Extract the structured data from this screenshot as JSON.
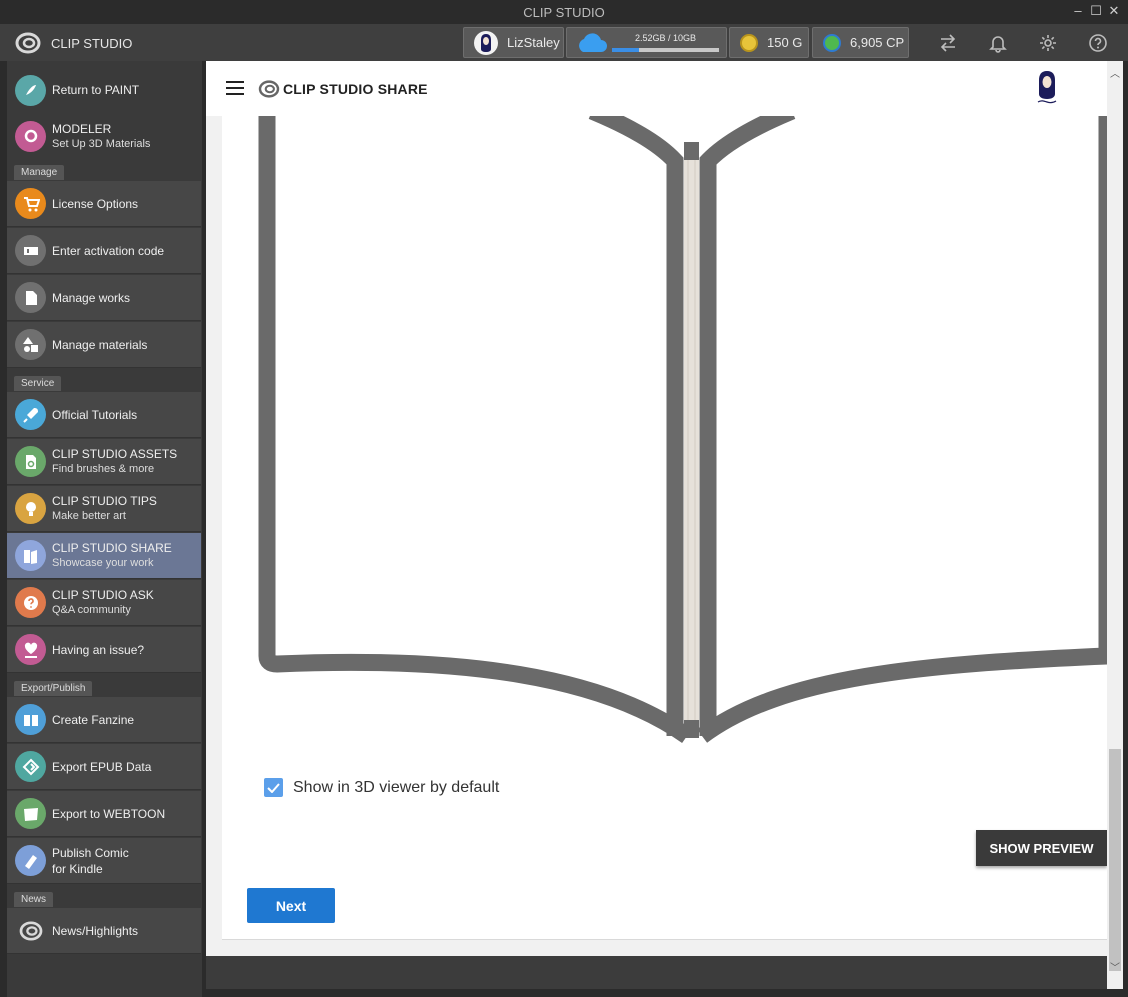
{
  "window": {
    "title": "CLIP STUDIO",
    "controls": [
      "–",
      "☐",
      "✕"
    ]
  },
  "appbar": {
    "brand": "CLIP STUDIO",
    "user": "LizStaley",
    "storage": {
      "text": "2.52GB / 10GB",
      "used_fraction": 0.252
    },
    "gold": "150 G",
    "cp": "6,905 CP",
    "icons": [
      "sync-icon",
      "bell-icon",
      "gear-icon",
      "help-icon"
    ]
  },
  "sidebar": {
    "top_items": [
      {
        "label": "Return to PAINT",
        "sub": "",
        "icon": "paint-icon",
        "color": "#5aa7a8"
      },
      {
        "label": "MODELER",
        "sub": "Set Up 3D Materials",
        "icon": "modeler-icon",
        "color": "#c25b93"
      }
    ],
    "sections": [
      {
        "title": "Manage",
        "items": [
          {
            "label": "License Options",
            "sub": "",
            "icon": "cart-icon",
            "color": "#e98a1c"
          },
          {
            "label": "Enter activation code",
            "sub": "",
            "icon": "ticket-icon",
            "color": "#707070"
          },
          {
            "label": "Manage works",
            "sub": "",
            "icon": "document-icon",
            "color": "#707070"
          },
          {
            "label": "Manage materials",
            "sub": "",
            "icon": "shapes-icon",
            "color": "#707070"
          }
        ]
      },
      {
        "title": "Service",
        "items": [
          {
            "label": "Official Tutorials",
            "sub": "",
            "icon": "rocket-icon",
            "color": "#4aa8d8"
          },
          {
            "label": "CLIP STUDIO ASSETS",
            "sub": "Find brushes & more",
            "icon": "assets-icon",
            "color": "#6aa86a"
          },
          {
            "label": "CLIP STUDIO TIPS",
            "sub": "Make better art",
            "icon": "lightbulb-icon",
            "color": "#d9a441"
          },
          {
            "label": "CLIP STUDIO SHARE",
            "sub": "Showcase your work",
            "icon": "share-icon",
            "color": "#6f8fd6",
            "active": true
          },
          {
            "label": "CLIP STUDIO ASK",
            "sub": "Q&A community",
            "icon": "question-icon",
            "color": "#e07a4c"
          },
          {
            "label": "Having an issue?",
            "sub": "",
            "icon": "heart-hand-icon",
            "color": "#c25b93"
          }
        ]
      },
      {
        "title": "Export/Publish",
        "items": [
          {
            "label": "Create Fanzine",
            "sub": "",
            "icon": "fanzine-icon",
            "color": "#4f9fd8"
          },
          {
            "label": "Export EPUB Data",
            "sub": "",
            "icon": "epub-icon",
            "color": "#4fa7a0"
          },
          {
            "label": "Export to WEBTOON",
            "sub": "",
            "icon": "webtoon-icon",
            "color": "#6aa86a"
          },
          {
            "label": "Publish Comic",
            "sub": "for Kindle",
            "icon": "kindle-icon",
            "color": "#7d9fd8"
          }
        ]
      },
      {
        "title": "News",
        "items": [
          {
            "label": "News/Highlights",
            "sub": "",
            "icon": "clipstudio-logo-icon",
            "color": "#3a3a3a"
          }
        ]
      }
    ]
  },
  "share": {
    "header_title": "CLIP STUDIO SHARE",
    "checkbox_label": "Show in 3D viewer by default",
    "checkbox_checked": true,
    "preview_button": "SHOW PREVIEW",
    "next_button": "Next"
  }
}
